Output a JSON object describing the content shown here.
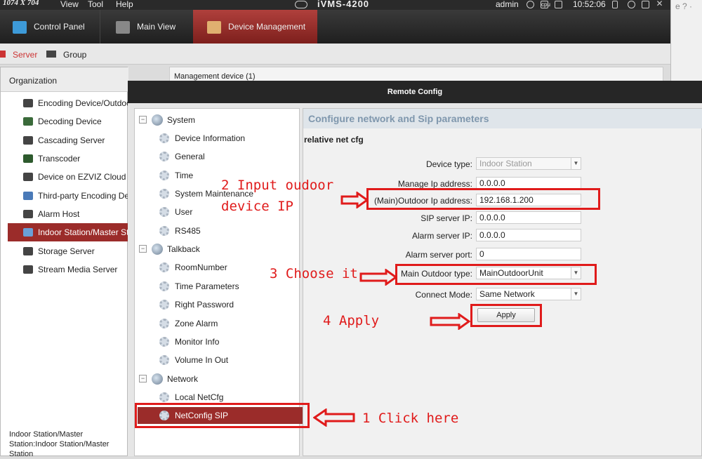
{
  "system_bar": {
    "resolution": "1074 X 704",
    "menu": [
      "View",
      "Tool",
      "Help"
    ],
    "app_title": "iVMS-4200",
    "user": "admin",
    "clock": "10:52:06"
  },
  "main_tabs": [
    {
      "label": "Control Panel"
    },
    {
      "label": "Main View"
    },
    {
      "label": "Device Management"
    }
  ],
  "sub_tabs": {
    "server": "Server",
    "group": "Group"
  },
  "organization": {
    "header": "Organization",
    "items": [
      "Encoding Device/Outdoor",
      "Decoding Device",
      "Cascading Server",
      "Transcoder",
      "Device on EZVIZ Cloud",
      "Third-party Encoding Device",
      "Alarm Host",
      "Indoor Station/Master Station",
      "Storage Server",
      "Stream Media Server"
    ],
    "selected_index": 7,
    "footer": "Indoor Station/Master Station:Indoor Station/Master Station"
  },
  "management": {
    "label": "Management device (1)"
  },
  "dialog": {
    "title": "Remote Config",
    "tree": {
      "system": {
        "label": "System",
        "children": [
          "Device Information",
          "General",
          "Time",
          "System Maintenance",
          "User",
          "RS485"
        ]
      },
      "talkback": {
        "label": "Talkback",
        "children": [
          "RoomNumber",
          "Time Parameters",
          "Right Password",
          "Zone Alarm",
          "Monitor Info",
          "Volume In Out"
        ]
      },
      "network": {
        "label": "Network",
        "children": [
          "Local NetCfg",
          "NetConfig SIP"
        ]
      }
    },
    "panel": {
      "heading": "Configure network and Sip parameters",
      "section": "relative net cfg",
      "fields": {
        "device_type": {
          "label": "Device type:",
          "value": "Indoor Station"
        },
        "manage_ip": {
          "label": "Manage Ip address:",
          "value": "0.0.0.0"
        },
        "outdoor_ip": {
          "label": "(Main)Outdoor Ip address:",
          "value": "192.168.1.200"
        },
        "sip_ip": {
          "label": "SIP server IP:",
          "value": "0.0.0.0"
        },
        "alarm_ip": {
          "label": "Alarm server IP:",
          "value": "0.0.0.0"
        },
        "alarm_port": {
          "label": "Alarm server port:",
          "value": "0"
        },
        "outdoor_type": {
          "label": "Main Outdoor type:",
          "value": "MainOutdoorUnit"
        },
        "connect_mode": {
          "label": "Connect Mode:",
          "value": "Same Network"
        }
      },
      "apply_label": "Apply"
    }
  },
  "annotations": {
    "step1": "1 Click here",
    "step2_line1": "2 Input oudoor",
    "step2_line2": "device IP",
    "step3": "3 Choose it",
    "step4": "4 Apply",
    "color": "#e01b1b"
  }
}
